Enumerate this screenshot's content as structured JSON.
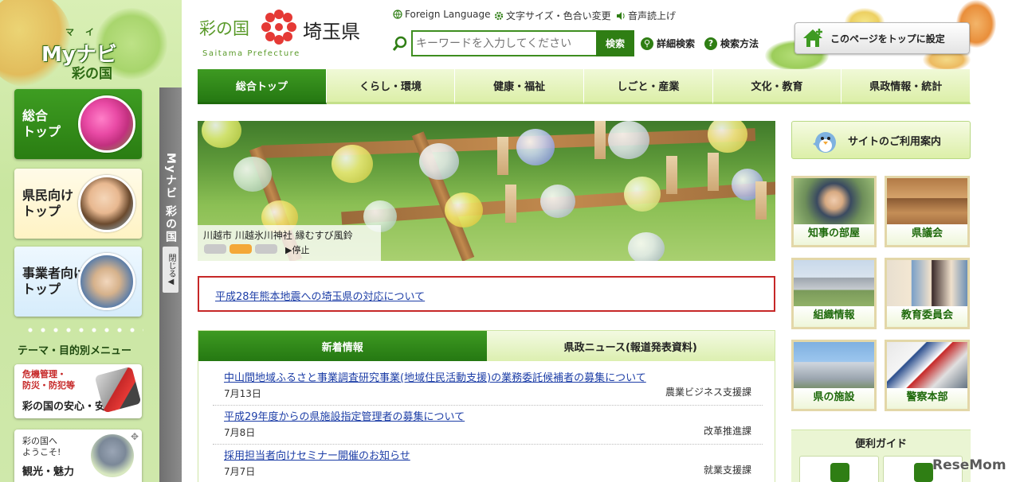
{
  "sidebar": {
    "logo_ruby": "マイ",
    "logo_main": "Myナビ",
    "logo_sub": "彩の国",
    "tiles": [
      {
        "label": "総合\nトップ"
      },
      {
        "label": "県民向け\nトップ"
      },
      {
        "label": "事業者向け\nトップ"
      }
    ],
    "theme_heading": "テーマ・目的別メニュー",
    "kiki": {
      "small": "危機管理・\n防災・防犯等",
      "main": "彩の国の安心・安全"
    },
    "kanko": {
      "small": "彩の国へ\nようこそ!",
      "main": "観光・魅力"
    },
    "strip_title": "Myナビ 彩の国",
    "strip_close": "閉じる◀"
  },
  "header": {
    "logo_left": "彩の国",
    "logo_right": "埼玉県",
    "logo_en": "Saitama Prefecture",
    "util": {
      "foreign": "Foreign Language",
      "size": "文字サイズ・色合い変更",
      "voice": "音声読上げ"
    },
    "search": {
      "placeholder": "キーワードを入力してください",
      "button": "検索",
      "advanced": "詳細検索",
      "howto": "検索方法"
    },
    "set_top": "このページをトップに設定"
  },
  "nav": [
    {
      "label": "総合トップ",
      "active": true
    },
    {
      "label": "くらし・環境"
    },
    {
      "label": "健康・福祉"
    },
    {
      "label": "しごと・産業"
    },
    {
      "label": "文化・教育"
    },
    {
      "label": "県政情報・統計"
    }
  ],
  "hero": {
    "caption": "川越市 川越氷川神社 縁むすび風鈴",
    "stop": "▶停止"
  },
  "alert": {
    "text": "平成28年熊本地震への埼玉県の対応について"
  },
  "news": {
    "tabs": [
      "新着情報",
      "県政ニュース(報道発表資料)"
    ],
    "items": [
      {
        "title": "中山間地域ふるさと事業調査研究事業(地域住民活動支援)の業務委託候補者の募集について",
        "date": "7月13日",
        "dept": "農業ビジネス支援課"
      },
      {
        "title": "平成29年度からの県施設指定管理者の募集について",
        "date": "7月8日",
        "dept": "改革推進課"
      },
      {
        "title": "採用担当者向けセミナー開催のお知らせ",
        "date": "7月7日",
        "dept": "就業支援課"
      }
    ]
  },
  "right": {
    "guide": "サイトのご利用案内",
    "tiles": [
      "知事の部屋",
      "県議会",
      "組織情報",
      "教育委員会",
      "県の施設",
      "警察本部"
    ],
    "benri_title": "便利ガイド"
  },
  "watermark": "ReseMom",
  "colors": {
    "brand_green": "#2f7e14",
    "nav_light": "#dcefa8",
    "alert_red": "#c62828",
    "link_blue": "#1d3ea7",
    "active_dot": "#f4a838"
  },
  "icons": [
    "globe-icon",
    "gear-icon",
    "speaker-icon",
    "search-icon",
    "question-icon",
    "house-icon",
    "bird-icon",
    "flower-logo-icon",
    "move-icon"
  ]
}
